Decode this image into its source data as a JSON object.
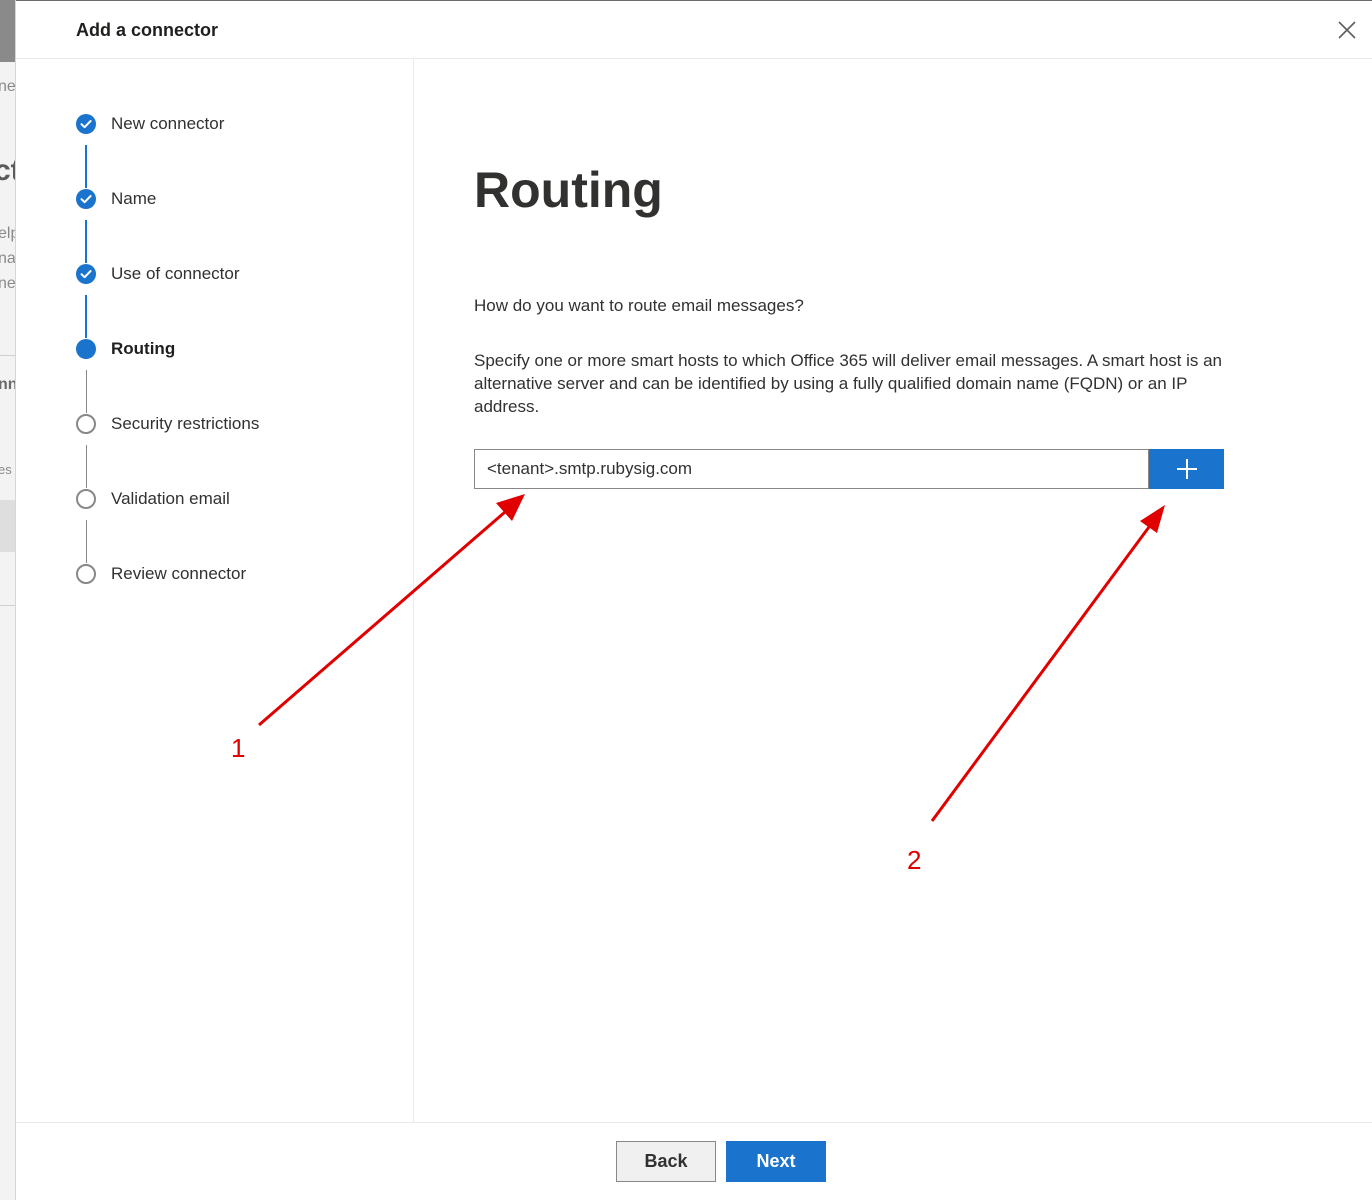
{
  "dialog": {
    "title": "Add a connector",
    "close_icon": "close-icon"
  },
  "steps": [
    {
      "label": "New connector",
      "status": "completed"
    },
    {
      "label": "Name",
      "status": "completed"
    },
    {
      "label": "Use of connector",
      "status": "completed"
    },
    {
      "label": "Routing",
      "status": "current"
    },
    {
      "label": "Security restrictions",
      "status": "pending"
    },
    {
      "label": "Validation email",
      "status": "pending"
    },
    {
      "label": "Review connector",
      "status": "pending"
    }
  ],
  "main": {
    "title": "Routing",
    "question": "How do you want to route email messages?",
    "description": "Specify one or more smart hosts to which Office 365 will deliver email messages. A smart host is an alternative server and can be identified by using a fully qualified domain name (FQDN) or an IP address.",
    "smart_host_value": "<tenant>.smtp.rubysig.com",
    "add_icon": "plus-icon"
  },
  "footer": {
    "back_label": "Back",
    "next_label": "Next"
  },
  "annotations": {
    "label_1": "1",
    "label_2": "2",
    "color": "#e00000"
  },
  "background_fragments": [
    "ne",
    "ct",
    "elp",
    "nat",
    "ner",
    "nn",
    "es"
  ],
  "colors": {
    "accent": "#1a73cc",
    "text": "#323130"
  }
}
